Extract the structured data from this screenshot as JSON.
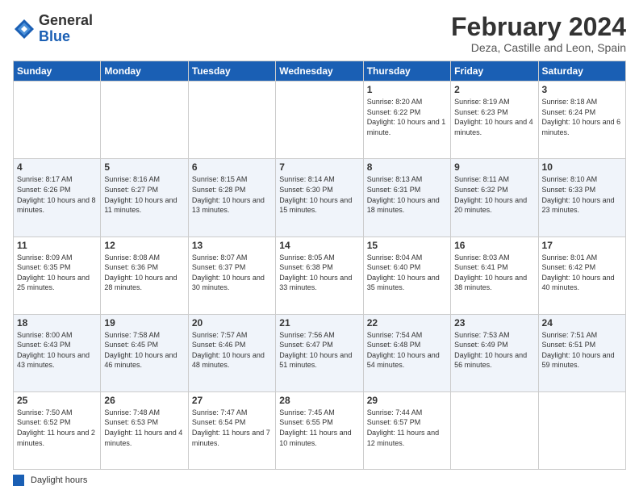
{
  "logo": {
    "general": "General",
    "blue": "Blue"
  },
  "title": "February 2024",
  "subtitle": "Deza, Castille and Leon, Spain",
  "days_of_week": [
    "Sunday",
    "Monday",
    "Tuesday",
    "Wednesday",
    "Thursday",
    "Friday",
    "Saturday"
  ],
  "footer": {
    "legend_label": "Daylight hours"
  },
  "weeks": [
    [
      {
        "day": "",
        "info": ""
      },
      {
        "day": "",
        "info": ""
      },
      {
        "day": "",
        "info": ""
      },
      {
        "day": "",
        "info": ""
      },
      {
        "day": "1",
        "info": "Sunrise: 8:20 AM\nSunset: 6:22 PM\nDaylight: 10 hours and 1 minute."
      },
      {
        "day": "2",
        "info": "Sunrise: 8:19 AM\nSunset: 6:23 PM\nDaylight: 10 hours and 4 minutes."
      },
      {
        "day": "3",
        "info": "Sunrise: 8:18 AM\nSunset: 6:24 PM\nDaylight: 10 hours and 6 minutes."
      }
    ],
    [
      {
        "day": "4",
        "info": "Sunrise: 8:17 AM\nSunset: 6:26 PM\nDaylight: 10 hours and 8 minutes."
      },
      {
        "day": "5",
        "info": "Sunrise: 8:16 AM\nSunset: 6:27 PM\nDaylight: 10 hours and 11 minutes."
      },
      {
        "day": "6",
        "info": "Sunrise: 8:15 AM\nSunset: 6:28 PM\nDaylight: 10 hours and 13 minutes."
      },
      {
        "day": "7",
        "info": "Sunrise: 8:14 AM\nSunset: 6:30 PM\nDaylight: 10 hours and 15 minutes."
      },
      {
        "day": "8",
        "info": "Sunrise: 8:13 AM\nSunset: 6:31 PM\nDaylight: 10 hours and 18 minutes."
      },
      {
        "day": "9",
        "info": "Sunrise: 8:11 AM\nSunset: 6:32 PM\nDaylight: 10 hours and 20 minutes."
      },
      {
        "day": "10",
        "info": "Sunrise: 8:10 AM\nSunset: 6:33 PM\nDaylight: 10 hours and 23 minutes."
      }
    ],
    [
      {
        "day": "11",
        "info": "Sunrise: 8:09 AM\nSunset: 6:35 PM\nDaylight: 10 hours and 25 minutes."
      },
      {
        "day": "12",
        "info": "Sunrise: 8:08 AM\nSunset: 6:36 PM\nDaylight: 10 hours and 28 minutes."
      },
      {
        "day": "13",
        "info": "Sunrise: 8:07 AM\nSunset: 6:37 PM\nDaylight: 10 hours and 30 minutes."
      },
      {
        "day": "14",
        "info": "Sunrise: 8:05 AM\nSunset: 6:38 PM\nDaylight: 10 hours and 33 minutes."
      },
      {
        "day": "15",
        "info": "Sunrise: 8:04 AM\nSunset: 6:40 PM\nDaylight: 10 hours and 35 minutes."
      },
      {
        "day": "16",
        "info": "Sunrise: 8:03 AM\nSunset: 6:41 PM\nDaylight: 10 hours and 38 minutes."
      },
      {
        "day": "17",
        "info": "Sunrise: 8:01 AM\nSunset: 6:42 PM\nDaylight: 10 hours and 40 minutes."
      }
    ],
    [
      {
        "day": "18",
        "info": "Sunrise: 8:00 AM\nSunset: 6:43 PM\nDaylight: 10 hours and 43 minutes."
      },
      {
        "day": "19",
        "info": "Sunrise: 7:58 AM\nSunset: 6:45 PM\nDaylight: 10 hours and 46 minutes."
      },
      {
        "day": "20",
        "info": "Sunrise: 7:57 AM\nSunset: 6:46 PM\nDaylight: 10 hours and 48 minutes."
      },
      {
        "day": "21",
        "info": "Sunrise: 7:56 AM\nSunset: 6:47 PM\nDaylight: 10 hours and 51 minutes."
      },
      {
        "day": "22",
        "info": "Sunrise: 7:54 AM\nSunset: 6:48 PM\nDaylight: 10 hours and 54 minutes."
      },
      {
        "day": "23",
        "info": "Sunrise: 7:53 AM\nSunset: 6:49 PM\nDaylight: 10 hours and 56 minutes."
      },
      {
        "day": "24",
        "info": "Sunrise: 7:51 AM\nSunset: 6:51 PM\nDaylight: 10 hours and 59 minutes."
      }
    ],
    [
      {
        "day": "25",
        "info": "Sunrise: 7:50 AM\nSunset: 6:52 PM\nDaylight: 11 hours and 2 minutes."
      },
      {
        "day": "26",
        "info": "Sunrise: 7:48 AM\nSunset: 6:53 PM\nDaylight: 11 hours and 4 minutes."
      },
      {
        "day": "27",
        "info": "Sunrise: 7:47 AM\nSunset: 6:54 PM\nDaylight: 11 hours and 7 minutes."
      },
      {
        "day": "28",
        "info": "Sunrise: 7:45 AM\nSunset: 6:55 PM\nDaylight: 11 hours and 10 minutes."
      },
      {
        "day": "29",
        "info": "Sunrise: 7:44 AM\nSunset: 6:57 PM\nDaylight: 11 hours and 12 minutes."
      },
      {
        "day": "",
        "info": ""
      },
      {
        "day": "",
        "info": ""
      }
    ]
  ]
}
